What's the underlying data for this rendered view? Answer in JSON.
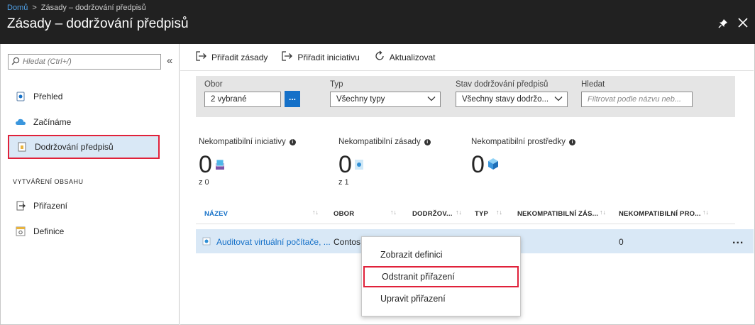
{
  "breadcrumb": {
    "home": "Domů",
    "separator": ">",
    "current": "Zásady – dodržování předpisů"
  },
  "blade": {
    "title": "Zásady – dodržování předpisů",
    "pin_icon": "pin-icon",
    "close_icon": "close-icon"
  },
  "sidebar": {
    "search_placeholder": "Hledat (Ctrl+/)",
    "collapse": "«",
    "items": [
      {
        "label": "Přehled",
        "icon": "overview-icon"
      },
      {
        "label": "Začínáme",
        "icon": "cloud-icon"
      },
      {
        "label": "Dodržování předpisů",
        "icon": "compliance-icon",
        "active": true
      }
    ],
    "section_title": "VYTVÁŘENÍ OBSAHU",
    "section_items": [
      {
        "label": "Přiřazení",
        "icon": "assignment-icon"
      },
      {
        "label": "Definice",
        "icon": "definition-icon"
      }
    ]
  },
  "toolbar": {
    "assign_policy": "Přiřadit zásady",
    "assign_initiative": "Přiřadit iniciativu",
    "refresh": "Aktualizovat"
  },
  "filters": {
    "scope_label": "Obor",
    "scope_value": "2 vybrané",
    "scope_button": "...",
    "type_label": "Typ",
    "type_value": "Všechny typy",
    "state_label": "Stav dodržování předpisů",
    "state_value": "Všechny stavy dodržo...",
    "search_label": "Hledat",
    "search_placeholder": "Filtrovat podle názvu neb..."
  },
  "stats": [
    {
      "label": "Nekompatibilní iniciativy",
      "value": "0",
      "sub": "z 0"
    },
    {
      "label": "Nekompatibilní zásady",
      "value": "0",
      "sub": "z 1"
    },
    {
      "label": "Nekompatibilní prostředky",
      "value": "0",
      "sub": ""
    }
  ],
  "table": {
    "columns": [
      "NÁZEV",
      "OBOR",
      "DODRŽOV...",
      "TYP",
      "NEKOMPATIBILNÍ ZÁS...",
      "NEKOMPATIBILNÍ PRO..."
    ],
    "rows": [
      {
        "name": "Auditovat virtuální počítače, ...",
        "scope": "Contos",
        "noncompliant_resources": "0",
        "more": "..."
      }
    ]
  },
  "context_menu": {
    "items": [
      "Zobrazit definici",
      "Odstranit přiřazení",
      "Upravit přiřazení"
    ]
  },
  "colors": {
    "accent": "#1470c8",
    "highlight": "#e0213a",
    "selected_bg": "#d9e8f6",
    "topbar": "#212121"
  }
}
